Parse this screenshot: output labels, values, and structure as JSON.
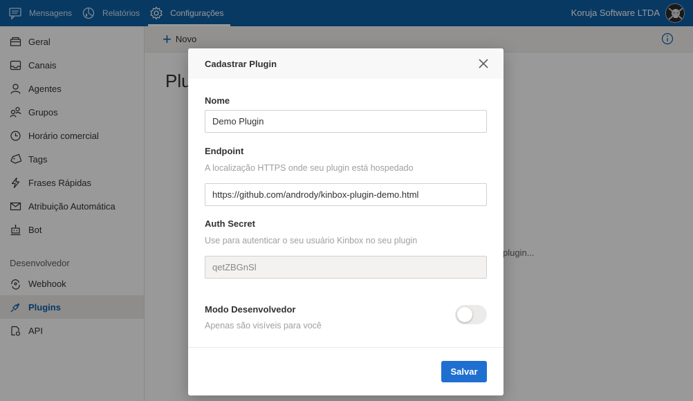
{
  "topnav": {
    "items": [
      {
        "label": "Mensagens",
        "icon": "chat-icon"
      },
      {
        "label": "Relatórios",
        "icon": "reports-icon"
      },
      {
        "label": "Configurações",
        "icon": "gear-icon",
        "active": true
      }
    ],
    "company": "Koruja Software LTDA"
  },
  "sidebar": {
    "items": [
      {
        "label": "Geral",
        "icon": "general-icon"
      },
      {
        "label": "Canais",
        "icon": "inbox-icon"
      },
      {
        "label": "Agentes",
        "icon": "person-icon"
      },
      {
        "label": "Grupos",
        "icon": "people-icon"
      },
      {
        "label": "Horário comercial",
        "icon": "clock-icon"
      },
      {
        "label": "Tags",
        "icon": "tag-icon"
      },
      {
        "label": "Frases Rápidas",
        "icon": "lightning-icon"
      },
      {
        "label": "Atribuição Automática",
        "icon": "mail-icon"
      },
      {
        "label": "Bot",
        "icon": "bot-icon"
      }
    ],
    "section_title": "Desenvolvedor",
    "dev_items": [
      {
        "label": "Webhook",
        "icon": "webhook-icon"
      },
      {
        "label": "Plugins",
        "icon": "plugin-icon",
        "active": true
      },
      {
        "label": "API",
        "icon": "api-icon"
      }
    ]
  },
  "main": {
    "new_label": "Novo",
    "page_title": "Plu",
    "bg_hint": "plugin..."
  },
  "modal": {
    "title": "Cadastrar Plugin",
    "nome": {
      "label": "Nome",
      "value": "Demo Plugin"
    },
    "endpoint": {
      "label": "Endpoint",
      "help": "A localização HTTPS onde seu plugin está hospedado",
      "value": "https://github.com/andrody/kinbox-plugin-demo.html"
    },
    "auth": {
      "label": "Auth Secret",
      "help": "Use para autenticar o seu usuário Kinbox no seu plugin",
      "value": "qetZBGnSl"
    },
    "dev_mode": {
      "label": "Modo Desenvolvedor",
      "help": "Apenas são visíveis para você",
      "enabled": false
    },
    "save_label": "Salvar"
  },
  "colors": {
    "topbar": "#0d5fa6",
    "accent": "#1f6fd1",
    "active_text": "#0d5fa6"
  }
}
